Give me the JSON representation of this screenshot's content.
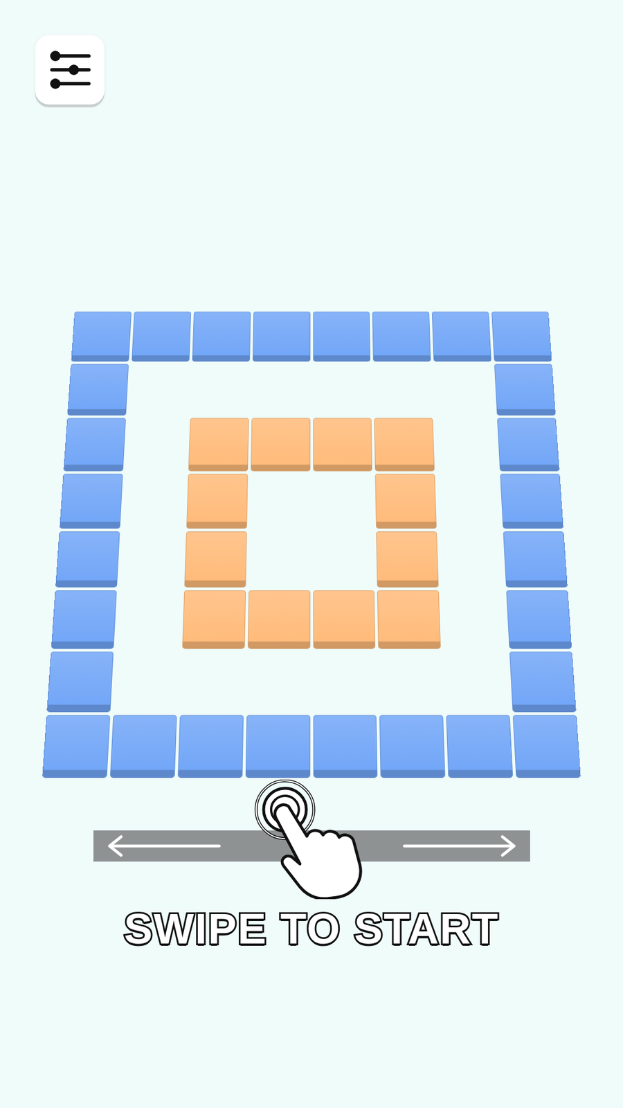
{
  "board": {
    "rows": [
      "BBBBBBBB",
      "B......B",
      "B.OOOO.B",
      "B.O..O.B",
      "B.O..O.B",
      "B.OOOO.B",
      "B......B",
      "BBBBBBBB"
    ],
    "tile_colors": {
      "B": "#72a6f7",
      "O": "#ffbb7a"
    }
  },
  "prompt": "SWIPE TO START"
}
